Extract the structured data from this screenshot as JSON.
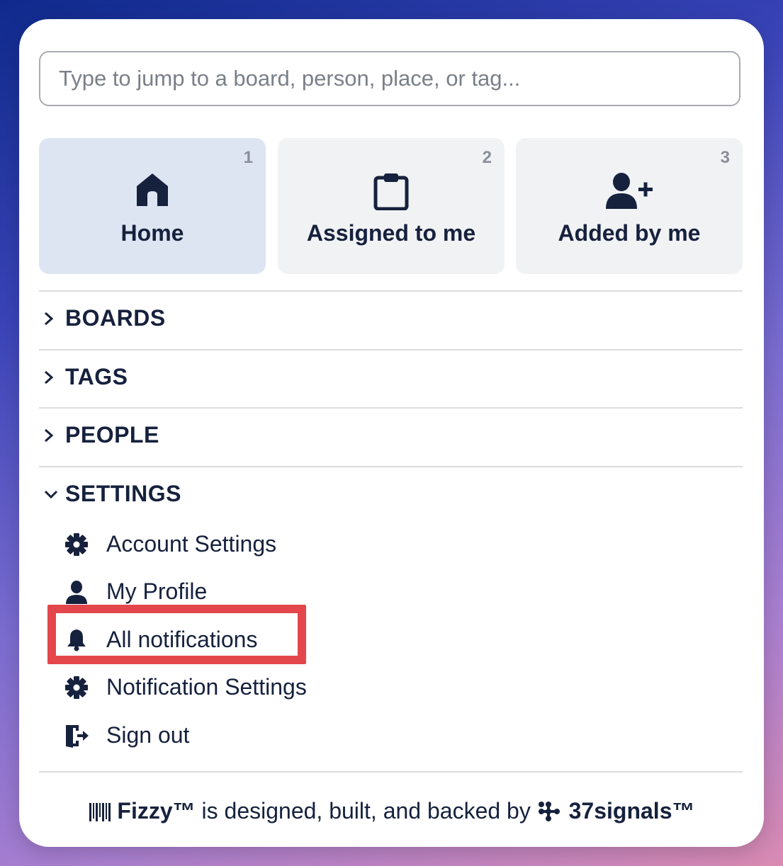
{
  "search": {
    "placeholder": "Type to jump to a board, person, place, or tag..."
  },
  "tiles": [
    {
      "label": "Home",
      "shortcut": "1",
      "icon": "home-icon",
      "active": true
    },
    {
      "label": "Assigned to me",
      "shortcut": "2",
      "icon": "clipboard-icon",
      "active": false
    },
    {
      "label": "Added by me",
      "shortcut": "3",
      "icon": "user-plus-icon",
      "active": false
    }
  ],
  "sections": {
    "boards": {
      "label": "BOARDS",
      "expanded": false
    },
    "tags": {
      "label": "TAGS",
      "expanded": false
    },
    "people": {
      "label": "PEOPLE",
      "expanded": false
    },
    "settings": {
      "label": "SETTINGS",
      "expanded": true,
      "items": [
        {
          "label": "Account Settings",
          "icon": "gear-icon"
        },
        {
          "label": "My Profile",
          "icon": "person-icon"
        },
        {
          "label": "All notifications",
          "icon": "bell-icon"
        },
        {
          "label": "Notification Settings",
          "icon": "gear-icon"
        },
        {
          "label": "Sign out",
          "icon": "sign-out-icon"
        }
      ]
    }
  },
  "footer": {
    "product": "Fizzy™",
    "text": " is designed, built, and backed by ",
    "company": "37signals™"
  },
  "colors": {
    "highlight": "#e4474b",
    "active_tile": "#dde5f3",
    "tile": "#f1f2f4",
    "text": "#16213d"
  }
}
